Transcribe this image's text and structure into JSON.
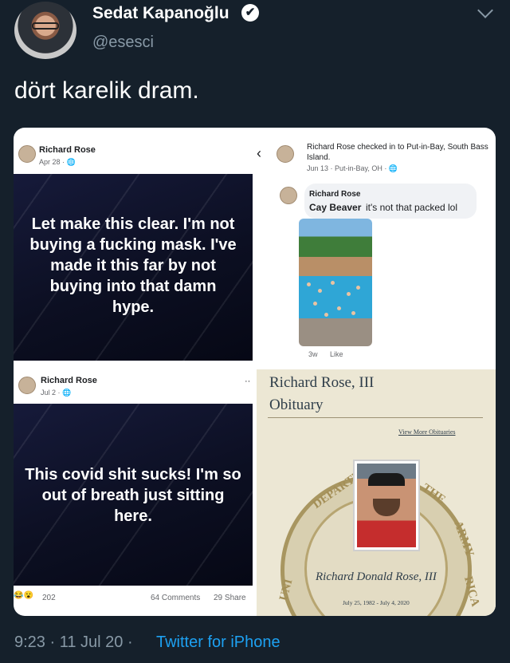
{
  "tweet": {
    "display_name": "Sedat Kapanoğlu",
    "handle": "@esesci",
    "verified_mark": "✔",
    "text": "dört karelik dram.",
    "timestamp": "9:23 · 11 Jul 20 ·",
    "source": "Twitter for iPhone",
    "colors": {
      "background": "#15202b",
      "link": "#1da1f2",
      "muted": "#8899a6"
    }
  },
  "collage": {
    "post1": {
      "author": "Richard Rose",
      "date": "Apr 28 · ",
      "text": "Let make this clear. I'm not buying a fucking mask. I've made it this far by not buying into that damn hype."
    },
    "post2": {
      "author_line": "Richard Rose checked in to Put-in-Bay, South Bass Island.",
      "date": "Jun 13 · Put-in-Bay, OH · ",
      "back_icon": "‹",
      "comment_author": "Richard Rose",
      "comment_tag": "Cay Beaver",
      "comment_text": "it's not that packed lol",
      "comment_age": "3w",
      "like_label": "Like"
    },
    "post3": {
      "author": "Richard Rose",
      "date": "Jul 2 · ",
      "more_icon": "··",
      "text": "This covid shit sucks! I'm so out of breath just sitting here.",
      "reactions": "202",
      "comments": "64 Comments",
      "shares": "29 Share"
    },
    "post4": {
      "title": "Richard Rose, III",
      "subtitle": "Obituary",
      "link": "View More Obituaries",
      "seal_words": [
        "DEPARTM",
        "THE",
        "ARMY",
        "UNI",
        "RICA"
      ],
      "name": "Richard Donald Rose, III",
      "dates": "July 25, 1982 - July 4, 2020"
    }
  }
}
